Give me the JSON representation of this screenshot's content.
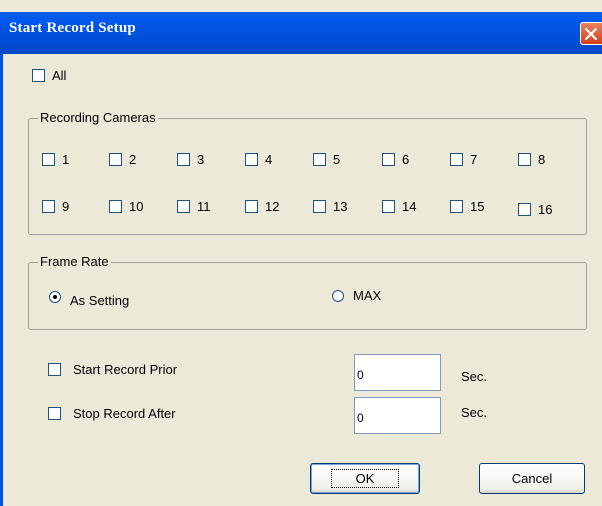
{
  "window": {
    "title": "Start Record Setup"
  },
  "all": {
    "label": "All"
  },
  "recording_cameras": {
    "title": "Recording Cameras",
    "cameras": [
      "1",
      "2",
      "3",
      "4",
      "5",
      "6",
      "7",
      "8",
      "9",
      "10",
      "11",
      "12",
      "13",
      "14",
      "15",
      "16"
    ]
  },
  "frame_rate": {
    "title": "Frame Rate",
    "options": [
      {
        "label": "As Setting",
        "selected": true
      },
      {
        "label": "MAX",
        "selected": false
      }
    ]
  },
  "start_prior": {
    "label": "Start Record Prior",
    "value": "0",
    "unit": "Sec."
  },
  "stop_after": {
    "label": "Stop Record After",
    "value": "0",
    "unit": "Sec."
  },
  "buttons": {
    "ok": "OK",
    "cancel": "Cancel"
  },
  "colors": {
    "titlebar": "#0054e3",
    "dialog_bg": "#ece9d8",
    "close_button": "#e06b3c"
  }
}
